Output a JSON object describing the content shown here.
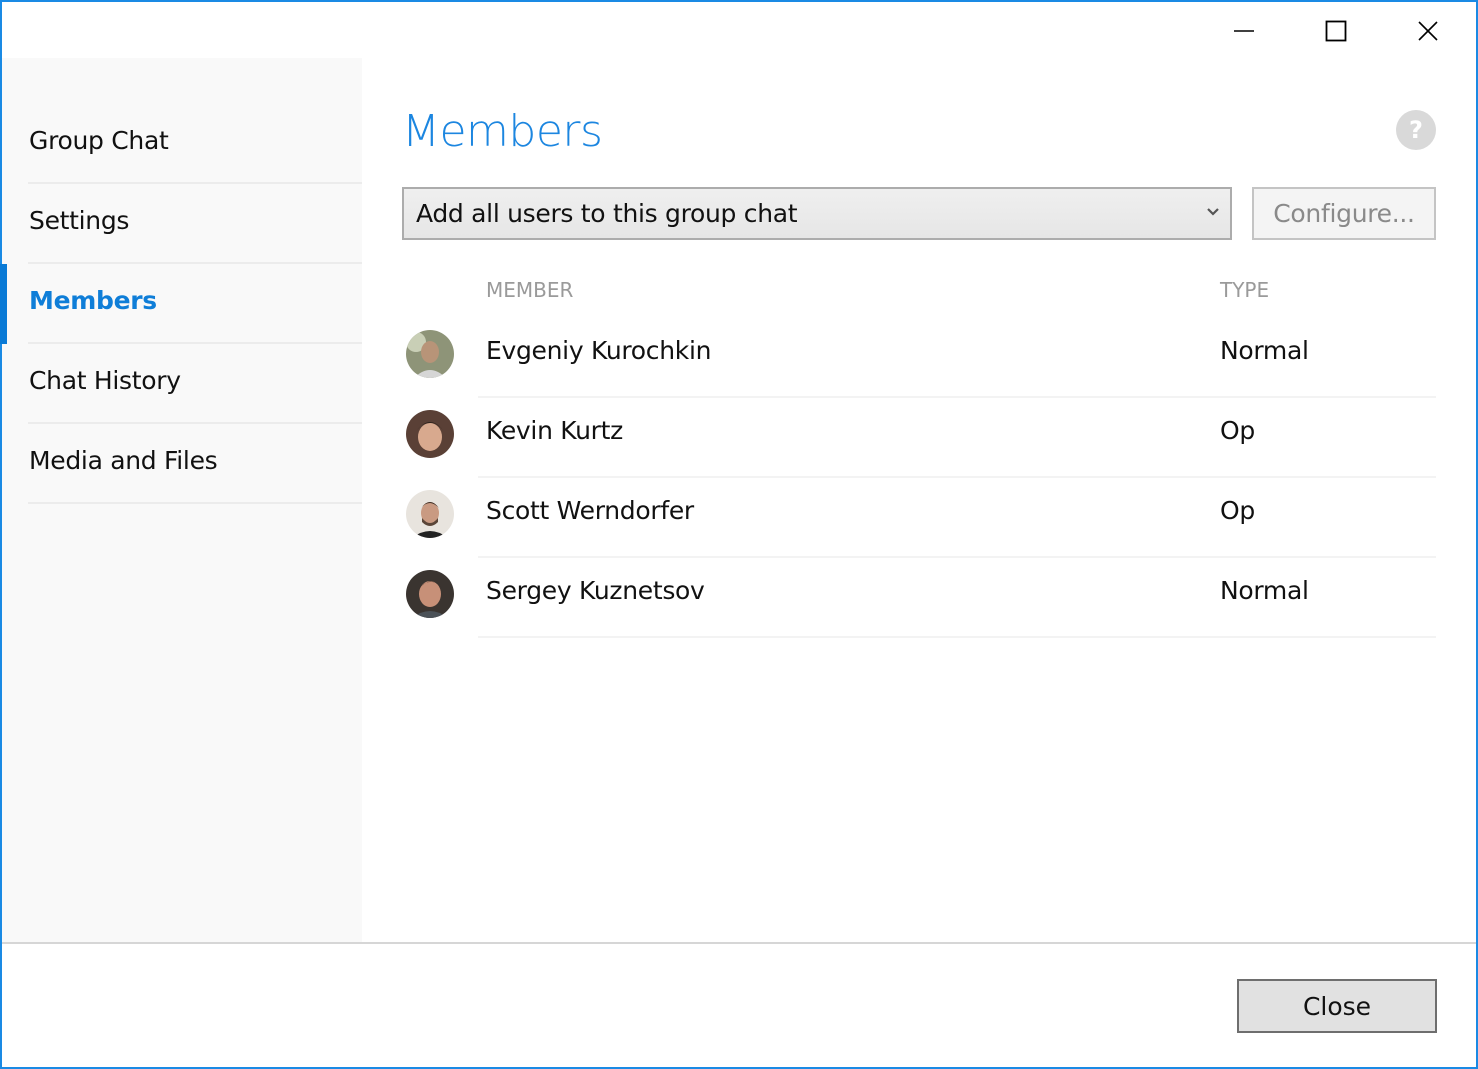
{
  "window": {
    "controls": {
      "minimize_icon": "minimize-icon",
      "maximize_icon": "maximize-icon",
      "close_icon": "close-icon"
    },
    "accent_color": "#1a8ae4"
  },
  "sidebar": {
    "items": [
      {
        "label": "Group Chat",
        "active": false
      },
      {
        "label": "Settings",
        "active": false
      },
      {
        "label": "Members",
        "active": true
      },
      {
        "label": "Chat History",
        "active": false
      },
      {
        "label": "Media and Files",
        "active": false
      }
    ]
  },
  "main": {
    "title": "Members",
    "help_label": "?",
    "add_users_dropdown": {
      "selected": "Add all users to this group chat"
    },
    "configure_label": "Configure...",
    "table": {
      "headers": {
        "member": "MEMBER",
        "type": "TYPE"
      },
      "rows": [
        {
          "name": "Evgeniy Kurochkin",
          "type": "Normal"
        },
        {
          "name": "Kevin Kurtz",
          "type": "Op"
        },
        {
          "name": "Scott Werndorfer",
          "type": "Op"
        },
        {
          "name": "Sergey Kuznetsov",
          "type": "Normal"
        }
      ]
    }
  },
  "footer": {
    "close_label": "Close"
  }
}
